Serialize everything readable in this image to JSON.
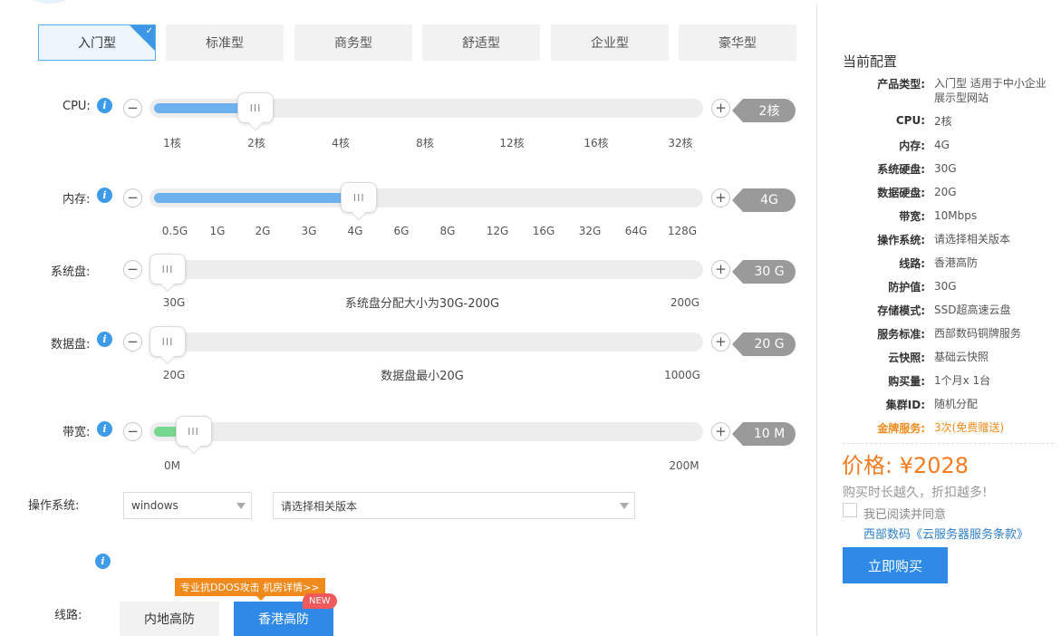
{
  "tabs": [
    "入门型",
    "标准型",
    "商务型",
    "舒适型",
    "企业型",
    "豪华型"
  ],
  "tab_check": "✓",
  "icons": {
    "info": "i",
    "minus": "−",
    "plus": "+",
    "grip": "III"
  },
  "colors": {
    "accent": "#3d97e6",
    "fill_blue": "#6db2ef",
    "fill_green": "#76d88f",
    "price": "#f47b20",
    "promo": "#f08a1c",
    "badge": "#f1595b"
  },
  "cpu": {
    "label": "CPU:",
    "value": "2核",
    "ticks": [
      "1核",
      "2核",
      "4核",
      "8核",
      "12核",
      "16核",
      "32核"
    ],
    "level_fraction": 0.17
  },
  "memory": {
    "label": "内存:",
    "value": "4G",
    "ticks": [
      "0.5G",
      "1G",
      "2G",
      "3G",
      "4G",
      "6G",
      "8G",
      "12G",
      "16G",
      "32G",
      "64G",
      "128G"
    ],
    "level_fraction": 0.37
  },
  "sys_disk": {
    "label": "系统盘:",
    "value": "30 G",
    "min": "30G",
    "max": "200G",
    "hint": "系统盘分配大小为30G-200G",
    "level_fraction": 0.0
  },
  "data_disk": {
    "label": "数据盘:",
    "value": "20 G",
    "min": "20G",
    "max": "1000G",
    "hint": "数据盘最小20G",
    "level_fraction": 0.0
  },
  "bandwidth": {
    "label": "带宽:",
    "value": "10 M",
    "min": "0M",
    "max": "200M",
    "level_fraction": 0.05
  },
  "os": {
    "label": "操作系统:",
    "selected": "windows",
    "version_selected": "请选择相关版本"
  },
  "line": {
    "label": "线路:",
    "promo": "专业抗DDOS攻击 机房详情>>",
    "new_badge": "NEW",
    "options": [
      "内地高防",
      "香港高防"
    ],
    "selected": "香港高防"
  },
  "summary": {
    "title": "当前配置",
    "rows": [
      {
        "key": "产品类型:",
        "val": "入门型 适用于中小企业展示型网站"
      },
      {
        "key": "CPU:",
        "val": "2核"
      },
      {
        "key": "内存:",
        "val": "4G"
      },
      {
        "key": "系统硬盘:",
        "val": "30G"
      },
      {
        "key": "数据硬盘:",
        "val": "20G"
      },
      {
        "key": "带宽:",
        "val": "10Mbps"
      },
      {
        "key": "操作系统:",
        "val": "请选择相关版本"
      },
      {
        "key": "线路:",
        "val": "香港高防"
      },
      {
        "key": "防护值:",
        "val": "30G"
      },
      {
        "key": "存储模式:",
        "val": "SSD超高速云盘"
      },
      {
        "key": "服务标准:",
        "val": "西部数码铜牌服务"
      },
      {
        "key": "云快照:",
        "val": "基础云快照"
      },
      {
        "key": "购买量:",
        "val": "1个月x 1台"
      },
      {
        "key": "集群ID:",
        "val": "随机分配"
      },
      {
        "key": "金牌服务:",
        "val": "3次(免费赠送)"
      }
    ],
    "price": "价格: ¥2028",
    "slogan": "购买时长越久，折扣越多!",
    "agree": "我已阅读并同意",
    "terms": "西部数码《云服务器服务条款》",
    "buy": "立即购买"
  }
}
